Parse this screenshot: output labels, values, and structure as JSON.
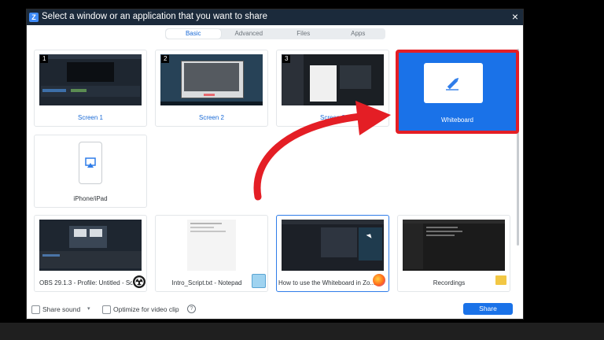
{
  "window": {
    "app_icon": "Z",
    "title": "Select a window or an application that you want to share",
    "close_glyph": "×",
    "tabs": [
      {
        "label": "Basic",
        "active": true
      },
      {
        "label": "Advanced",
        "active": false
      },
      {
        "label": "Files",
        "active": false
      },
      {
        "label": "Apps",
        "active": false
      }
    ]
  },
  "screens": [
    {
      "number": "1",
      "label": "Screen 1"
    },
    {
      "number": "2",
      "label": "Screen 2"
    },
    {
      "number": "3",
      "label": "Screen 3"
    }
  ],
  "whiteboard": {
    "label": "Whiteboard",
    "icon": "pencil-icon",
    "selected": true,
    "highlight_color": "#e41e25"
  },
  "device": {
    "label": "iPhone/iPad",
    "icon": "airplay-icon"
  },
  "windows": [
    {
      "label": "OBS 29.1.3 - Profile: Untitled - Sc...",
      "icon": "obs-icon"
    },
    {
      "label": "Intro_Script.txt - Notepad",
      "icon": "notepad-icon"
    },
    {
      "label": "How to use the Whiteboard in Zo...",
      "icon": "firefox-icon"
    },
    {
      "label": "Recordings",
      "icon": "folder-icon"
    }
  ],
  "footer": {
    "share_sound": "Share sound",
    "optimize_video": "Optimize for video clip",
    "help_glyph": "?",
    "share_button": "Share"
  },
  "colors": {
    "accent": "#1a72e8",
    "title_bar": "#1b2a3b",
    "annotation_arrow": "#e41e25"
  }
}
